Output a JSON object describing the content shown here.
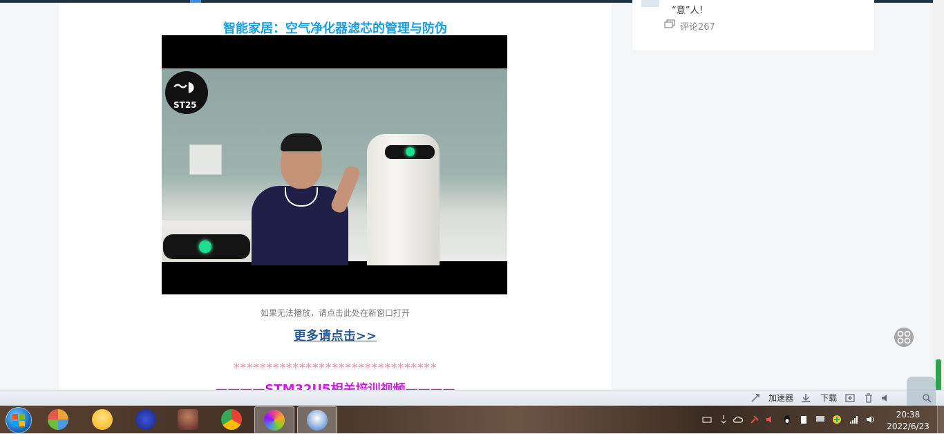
{
  "article": {
    "title": "智能家居：空气净化器滤芯的管理与防伪",
    "video": {
      "logo_text": "ST25"
    },
    "video_caption": "如果无法播放，请点击此处在新窗口打开",
    "more_link": "更多请点击>>",
    "stars": "*******************************",
    "section_title": "————STM32U5相关培训视频————"
  },
  "sidebar": {
    "card_text": "“意”人！",
    "comment_label": "评论267"
  },
  "statusbar": {
    "accelerator_label": "加速器",
    "download_label": "下载"
  },
  "taskbar": {
    "apps": [
      {
        "name": "start-orb"
      },
      {
        "name": "jigsaw-app",
        "color": "#e8a53a"
      },
      {
        "name": "emoticon-app",
        "color": "#f0c030"
      },
      {
        "name": "fs-app",
        "color": "#2a3cb0"
      },
      {
        "name": "avatar-app",
        "color": "#8a3a3a"
      },
      {
        "name": "chrome-app",
        "color": "#34a853"
      },
      {
        "name": "pinwheel-app",
        "color": "#e94b8a"
      },
      {
        "name": "penguin-app",
        "color": "#3b78c8"
      }
    ],
    "clock_time": "20:38",
    "clock_date": "2022/6/23"
  },
  "colors": {
    "title_blue": "#1aa0e0",
    "link_blue": "#2b5a97",
    "stars_pink": "#e88fa2",
    "section_magenta": "#d01de0"
  }
}
